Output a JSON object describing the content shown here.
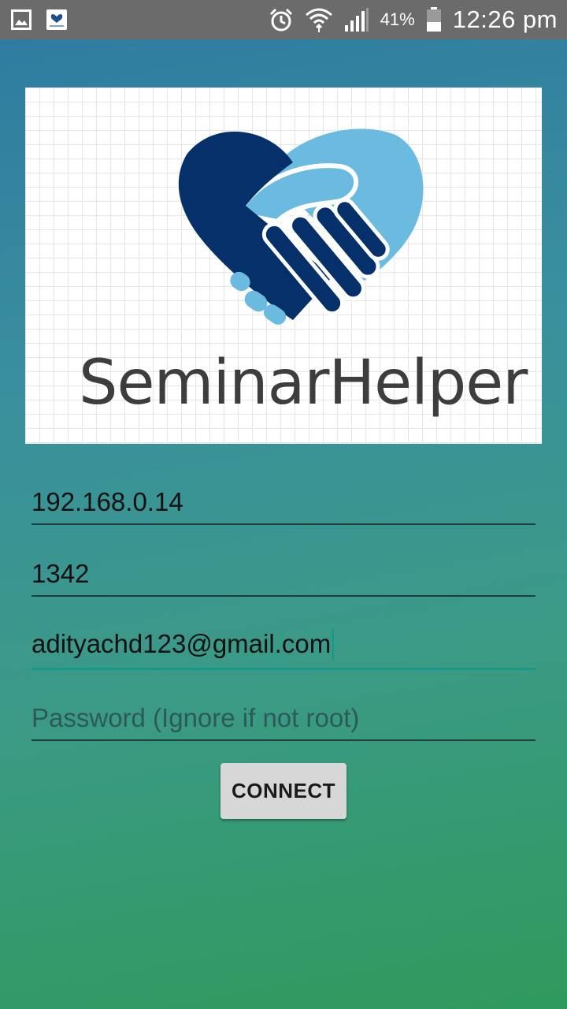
{
  "status_bar": {
    "notification_icons": [
      "gallery-icon",
      "app-notification-icon"
    ],
    "system_icons": [
      "alarm-icon",
      "wifi-icon",
      "signal-icon",
      "battery-icon"
    ],
    "battery_percent": "41%",
    "time": "12:26 pm"
  },
  "logo": {
    "brand_text": "SeminarHelper",
    "colors": {
      "dark_blue": "#06306a",
      "light_blue": "#6bbbe0",
      "text": "#3d3d3f"
    }
  },
  "form": {
    "host": {
      "value": "192.168.0.14",
      "placeholder": ""
    },
    "port": {
      "value": "1342",
      "placeholder": ""
    },
    "username": {
      "value": "adityachd123@gmail.com",
      "placeholder": ""
    },
    "password": {
      "value": "",
      "placeholder": "Password (Ignore if not root)"
    },
    "connect_label": "CONNECT"
  },
  "colors": {
    "accent": "#159a8a",
    "status_bar": "#6b6b6b"
  }
}
